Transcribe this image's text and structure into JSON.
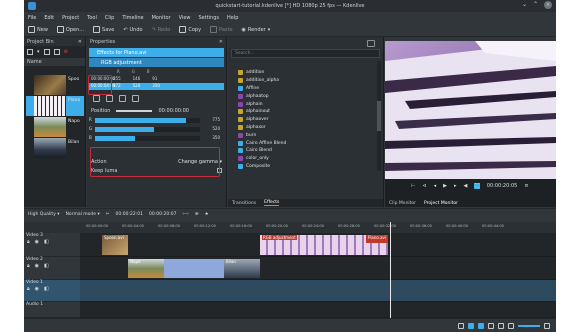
{
  "window": {
    "title": "quickstart-tutorial.kdenlive [*] HD 1080p 25 fps — Kdenlive"
  },
  "menu": [
    "File",
    "Edit",
    "Project",
    "Tool",
    "Clip",
    "Timeline",
    "Monitor",
    "View",
    "Settings",
    "Help"
  ],
  "toolbar": {
    "new": "New",
    "open": "Open...",
    "save": "Save",
    "undo": "Undo",
    "redo": "Redo",
    "copy": "Copy",
    "paste": "Paste",
    "render": "Render"
  },
  "project_bin": {
    "title": "Project Bin",
    "col_name": "Name",
    "clips": [
      {
        "label": "Spoo",
        "color": "#7a5a3a",
        "selected": false
      },
      {
        "label": "Piano",
        "color": "#b088c8",
        "selected": true
      },
      {
        "label": "Napo",
        "color": "#6a7a5a",
        "selected": false
      },
      {
        "label": "Bilan",
        "color": "#2f3a4a",
        "selected": false
      }
    ]
  },
  "properties": {
    "title": "Properties",
    "effects_for": "Effects for Piano.avi",
    "effect_name": "RGB adjustment",
    "keyframes": [
      {
        "time": "00:00:00:00",
        "r": "255",
        "g": "146",
        "b": "91",
        "selected": false
      },
      {
        "time": "00:00:04:00",
        "r": "172",
        "g": "520",
        "b": "350",
        "selected": true
      }
    ],
    "position_label": "Position",
    "position_value": "00:00:00:00",
    "sliders": [
      {
        "label": "R",
        "value": "775",
        "fraction": 0.87
      },
      {
        "label": "G",
        "value": "520",
        "fraction": 0.56
      },
      {
        "label": "B",
        "value": "350",
        "fraction": 0.38
      }
    ],
    "action_label": "Action",
    "action_value": "Change gamma",
    "keep_luma_label": "Keep luma"
  },
  "effects": {
    "search_placeholder": "Search...",
    "items": [
      {
        "name": "addition",
        "color": "#c8a62e"
      },
      {
        "name": "addition_alpha",
        "color": "#c8a62e"
      },
      {
        "name": "Affine",
        "color": "#3daee9"
      },
      {
        "name": "alphaatop",
        "color": "#8e44ad"
      },
      {
        "name": "alphain",
        "color": "#8e44ad"
      },
      {
        "name": "alphainout",
        "color": "#c8a62e"
      },
      {
        "name": "alphaover",
        "color": "#c8a62e"
      },
      {
        "name": "alphaxor",
        "color": "#c8a62e"
      },
      {
        "name": "burn",
        "color": "#8e44ad"
      },
      {
        "name": "Cairo Affine Blend",
        "color": "#3daee9"
      },
      {
        "name": "Cairo Blend",
        "color": "#3daee9"
      },
      {
        "name": "color_only",
        "color": "#8e44ad"
      },
      {
        "name": "Composite",
        "color": "#3daee9"
      }
    ],
    "tab_transitions": "Transitions",
    "tab_effects": "Effects"
  },
  "monitor": {
    "timecode": "00:00:20:05",
    "tab_clip": "Clip Monitor",
    "tab_project": "Project Monitor"
  },
  "timeline": {
    "quality": "High Quality",
    "mode": "Normal mode",
    "position": "00:00:22:01",
    "duration": "00:00:20:07",
    "ruler": [
      "00:00:00:00",
      "00:00:04:00",
      "00:00:08:00",
      "00:00:12:00",
      "00:00:16:00",
      "00:00:20:00",
      "00:00:24:00",
      "00:00:28:00",
      "00:00:32:00",
      "00:00:36:00",
      "00:00:40:00",
      "00:00:44:00"
    ],
    "tracks": [
      {
        "name": "Video 3"
      },
      {
        "name": "Video 2"
      },
      {
        "name": "Video 1"
      },
      {
        "name": "Audio 1"
      }
    ],
    "clip_labels": {
      "spoon": "Spoon.avi",
      "rgb": "RGB adjustment",
      "piano": "Piano.avi",
      "napo": "Napo",
      "bilan": "Bilan"
    }
  }
}
